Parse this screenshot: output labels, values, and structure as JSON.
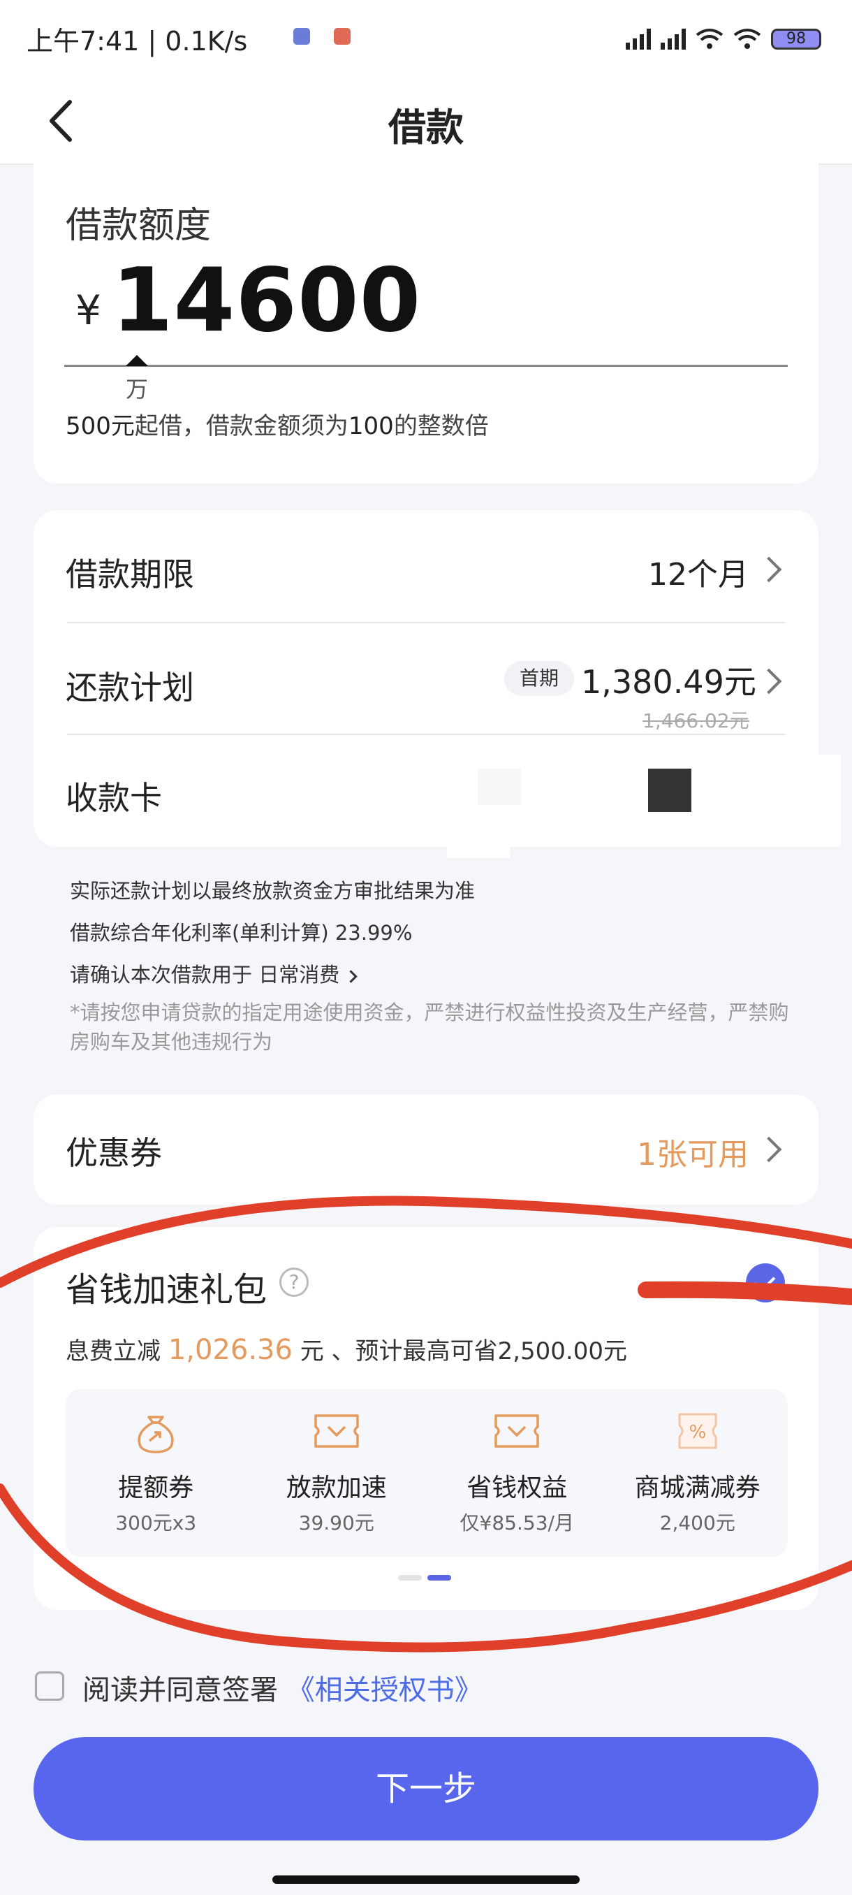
{
  "status_bar": {
    "time": "上午7:41 | 0.1K/s",
    "battery": "98"
  },
  "header": {
    "title": "借款"
  },
  "amount": {
    "label": "借款额度",
    "currency": "¥",
    "value": "14600",
    "unit": "万",
    "hint_strong_1": "500元",
    "hint_1": "起借，借款金额须为",
    "hint_strong_2": "100",
    "hint_2": "的整数倍"
  },
  "rows": {
    "term_label": "借款期限",
    "term_value": "12个月",
    "repay_label": "还款计划",
    "repay_badge": "首期",
    "repay_value": "1,380.49元",
    "repay_original": "1,466.02元",
    "card_label": "收款卡"
  },
  "notes": {
    "plan_note": "实际还款计划以最终放款资金方审批结果为准",
    "rate_note": "借款综合年化利率(单利计算) 23.99%",
    "purpose_note": "请确认本次借款用于 日常消费",
    "warning": "*请按您申请贷款的指定用途使用资金，严禁进行权益性投资及生产经营，严禁购房购车及其他违规行为"
  },
  "coupon": {
    "label": "优惠券",
    "value": "1张可用"
  },
  "package": {
    "title": "省钱加速礼包",
    "help": "?",
    "desc_prefix": "息费立减",
    "desc_amount": "1,026.36",
    "desc_suffix": "元 、预计最高可省2,500.00元",
    "benefits": [
      {
        "name": "提额券",
        "sub": "300元x3",
        "icon": "money-bag-icon"
      },
      {
        "name": "放款加速",
        "sub": "39.90元",
        "icon": "ticket-icon"
      },
      {
        "name": "省钱权益",
        "sub": "仅¥85.53/月",
        "icon": "ticket-icon"
      },
      {
        "name": "商城满减券",
        "sub": "2,400元",
        "icon": "percent-coupon-icon"
      }
    ]
  },
  "agreement": {
    "text": "阅读并同意签署",
    "link": "《相关授权书》"
  },
  "next_button": "下一步",
  "colors": {
    "primary": "#5866ee",
    "accent_orange": "#e49a5d",
    "annotation_red": "#e0402a"
  }
}
